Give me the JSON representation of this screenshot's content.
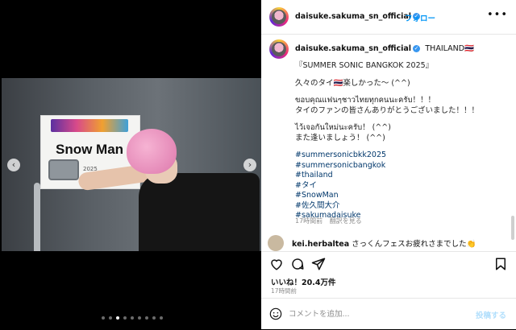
{
  "post": {
    "username": "daisuke.sakuma_sn_official",
    "verified_mark": "✓",
    "follow_label": "フォロー",
    "more_label": "•••",
    "location": "THAILAND🇹🇭",
    "caption_lines": [
      "『SUMMER SONIC BANGKOK 2025』",
      "",
      "久々のタイ🇹🇭楽しかった〜 (^^)",
      "",
      "ขอบคุณแฟนๆชาวไทยทุกคนนะครับ！！！",
      "タイのファンの皆さんありがとうございました！！！",
      "",
      "ไว้เจอกันใหม่นะครับ！ (^^)",
      "また逢いましょう！ (^^)"
    ],
    "hashtags": [
      "#summersonicbkk2025",
      "#summersonicbangkok",
      "#thailand",
      "#タイ",
      "#SnowMan",
      "#佐久間大介",
      "#sakumadaisuke"
    ],
    "caption_time": "17時間前",
    "translate_label": "翻訳を見る",
    "likes": "いいね！20.4万件",
    "post_time": "17時間前"
  },
  "photo": {
    "sign_text": "Snow Man",
    "sign_sub": "2025"
  },
  "comment": {
    "username": "kei.herbaltea",
    "text": "さっくんフェスお疲れさまでした👏"
  },
  "comment_box": {
    "placeholder": "コメントを追加...",
    "post_label": "投稿する"
  },
  "icons": {
    "like": "heart-icon",
    "comment": "comment-icon",
    "share": "share-icon",
    "save": "bookmark-icon",
    "emoji": "smiley-icon",
    "prev": "chevron-left-icon",
    "next": "chevron-right-icon"
  },
  "carousel": {
    "count": 9,
    "active_index": 2
  },
  "colors": {
    "link": "#00376b",
    "follow": "#0095f6",
    "verified": "#3897f0"
  }
}
